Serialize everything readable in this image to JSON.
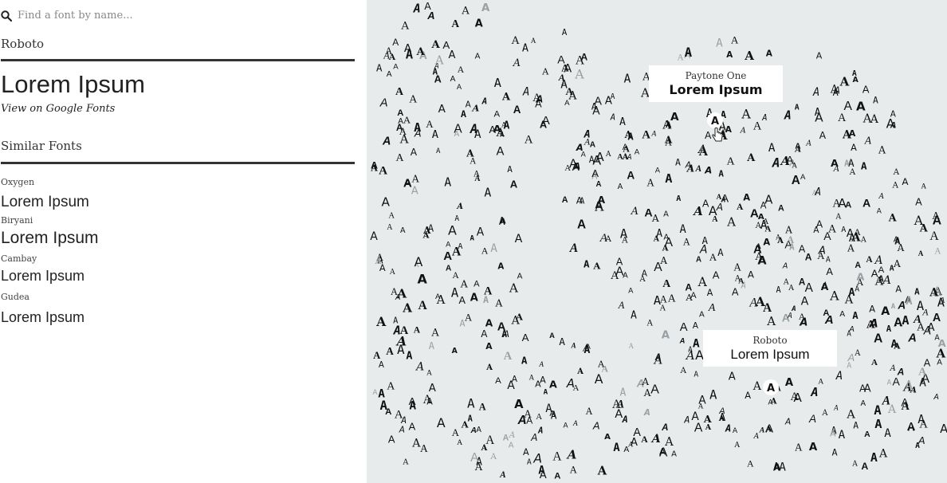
{
  "search": {
    "placeholder": "Find a font by name...",
    "icon": "search-icon"
  },
  "selected": {
    "font_name": "Roboto",
    "preview": "Lorem Ipsum",
    "view_link": "View on Google Fonts"
  },
  "similar": {
    "heading": "Similar Fonts",
    "items": [
      {
        "name": "Oxygen",
        "preview": "Lorem Ipsum"
      },
      {
        "name": "Biryani",
        "preview": "Lorem Ipsum"
      },
      {
        "name": "Cambay",
        "preview": "Lorem Ipsum"
      },
      {
        "name": "Gudea",
        "preview": "Lorem Ipsum"
      }
    ]
  },
  "map": {
    "glyph": "A",
    "background_color": "#e8ebec",
    "tooltips": [
      {
        "font_name": "Paytone One",
        "preview": "Lorem Ipsum"
      },
      {
        "font_name": "Roboto",
        "preview": "Lorem Ipsum"
      }
    ]
  }
}
